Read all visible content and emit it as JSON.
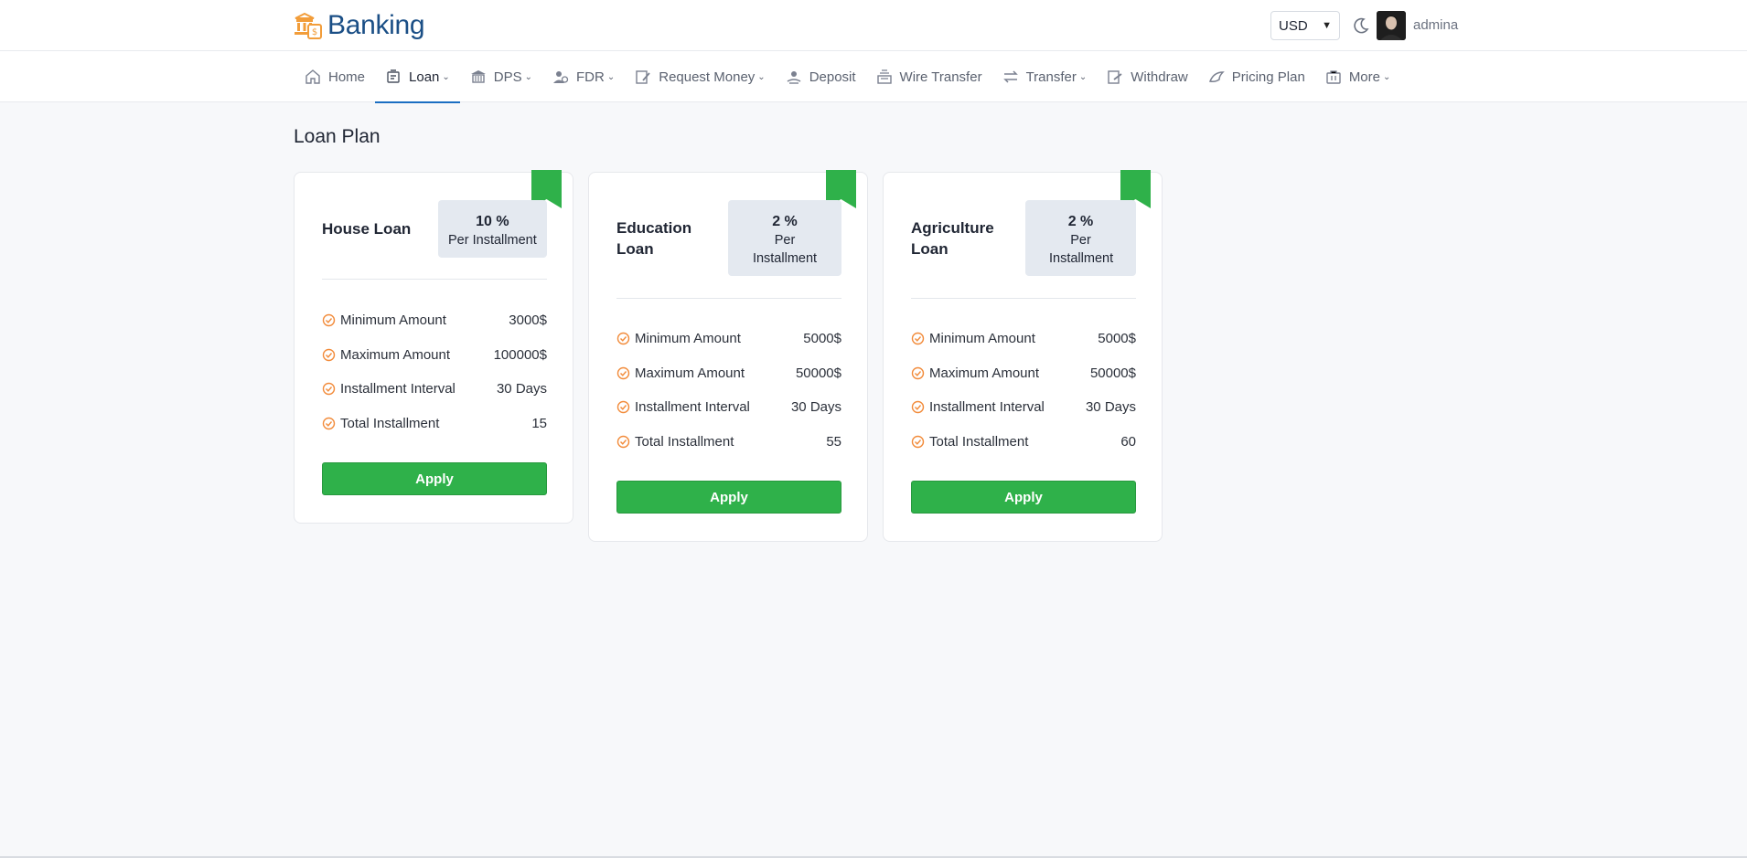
{
  "brand": {
    "name": "Banking",
    "accent": "#1b4f86",
    "logo_color": "#f29d3a"
  },
  "header": {
    "currency": "USD",
    "theme_icon": "moon-icon",
    "username": "admina"
  },
  "nav": [
    {
      "label": "Home",
      "icon": "home-icon",
      "dropdown": false,
      "active": false
    },
    {
      "label": "Loan",
      "icon": "loan-icon",
      "dropdown": true,
      "active": true
    },
    {
      "label": "DPS",
      "icon": "bank-icon",
      "dropdown": true,
      "active": false
    },
    {
      "label": "FDR",
      "icon": "users-icon",
      "dropdown": true,
      "active": false
    },
    {
      "label": "Request Money",
      "icon": "request-icon",
      "dropdown": true,
      "active": false
    },
    {
      "label": "Deposit",
      "icon": "deposit-icon",
      "dropdown": false,
      "active": false
    },
    {
      "label": "Wire Transfer",
      "icon": "wire-icon",
      "dropdown": false,
      "active": false
    },
    {
      "label": "Transfer",
      "icon": "transfer-icon",
      "dropdown": true,
      "active": false
    },
    {
      "label": "Withdraw",
      "icon": "withdraw-icon",
      "dropdown": false,
      "active": false
    },
    {
      "label": "Pricing Plan",
      "icon": "pricing-icon",
      "dropdown": false,
      "active": false
    },
    {
      "label": "More",
      "icon": "more-icon",
      "dropdown": true,
      "active": false
    }
  ],
  "page": {
    "title": "Loan Plan"
  },
  "plans": [
    {
      "name": "House Loan",
      "rate": "10 %",
      "rate_label": "Per Installment",
      "features": [
        {
          "label": "Minimum Amount",
          "value": "3000$"
        },
        {
          "label": "Maximum Amount",
          "value": "100000$"
        },
        {
          "label": "Installment Interval",
          "value": "30 Days"
        },
        {
          "label": "Total Installment",
          "value": "15"
        }
      ],
      "button": "Apply"
    },
    {
      "name": "Education Loan",
      "rate": "2 %",
      "rate_label": "Per Installment",
      "features": [
        {
          "label": "Minimum Amount",
          "value": "5000$"
        },
        {
          "label": "Maximum Amount",
          "value": "50000$"
        },
        {
          "label": "Installment Interval",
          "value": "30 Days"
        },
        {
          "label": "Total Installment",
          "value": "55"
        }
      ],
      "button": "Apply"
    },
    {
      "name": "Agriculture Loan",
      "rate": "2 %",
      "rate_label": "Per Installment",
      "features": [
        {
          "label": "Minimum Amount",
          "value": "5000$"
        },
        {
          "label": "Maximum Amount",
          "value": "50000$"
        },
        {
          "label": "Installment Interval",
          "value": "30 Days"
        },
        {
          "label": "Total Installment",
          "value": "60"
        }
      ],
      "button": "Apply"
    }
  ],
  "colors": {
    "primary_button": "#2fb14a",
    "ribbon": "#2fb14a",
    "check": "#f28b3a",
    "active_underline": "#1b6ec2"
  }
}
